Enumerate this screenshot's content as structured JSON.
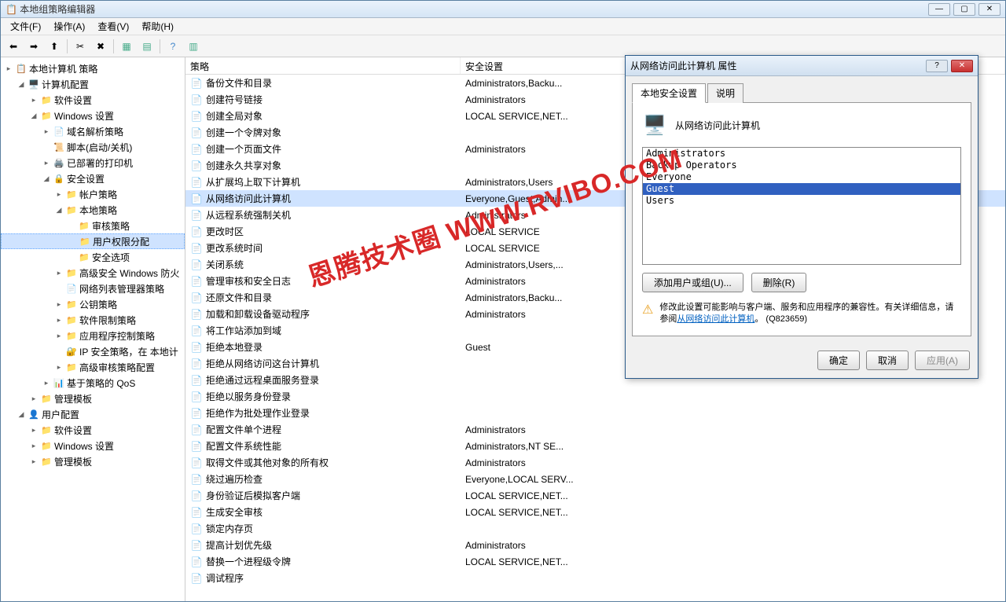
{
  "window": {
    "title": "本地组策略编辑器"
  },
  "menu": {
    "file": "文件(F)",
    "action": "操作(A)",
    "view": "查看(V)",
    "help": "帮助(H)"
  },
  "tree": {
    "root": "本地计算机 策略",
    "computer_config": "计算机配置",
    "software_settings": "软件设置",
    "windows_settings": "Windows 设置",
    "dns_policy": "域名解析策略",
    "scripts": "脚本(启动/关机)",
    "deployed_printers": "已部署的打印机",
    "security_settings": "安全设置",
    "account_policies": "帐户策略",
    "local_policies": "本地策略",
    "audit_policy": "审核策略",
    "user_rights": "用户权限分配",
    "security_options": "安全选项",
    "advanced_windows": "高级安全 Windows 防火",
    "network_list": "网络列表管理器策略",
    "public_key": "公钥策略",
    "software_restrict": "软件限制策略",
    "app_control": "应用程序控制策略",
    "ip_security": "IP 安全策略，在 本地计",
    "advanced_audit": "高级审核策略配置",
    "policy_qos": "基于策略的 QoS",
    "admin_templates": "管理模板",
    "user_config": "用户配置",
    "user_software": "软件设置",
    "user_windows": "Windows 设置",
    "user_admin": "管理模板"
  },
  "list": {
    "col_policy": "策略",
    "col_security": "安全设置",
    "rows": [
      {
        "name": "备份文件和目录",
        "val": "Administrators,Backu..."
      },
      {
        "name": "创建符号链接",
        "val": "Administrators"
      },
      {
        "name": "创建全局对象",
        "val": "LOCAL SERVICE,NET..."
      },
      {
        "name": "创建一个令牌对象",
        "val": ""
      },
      {
        "name": "创建一个页面文件",
        "val": "Administrators"
      },
      {
        "name": "创建永久共享对象",
        "val": ""
      },
      {
        "name": "从扩展坞上取下计算机",
        "val": "Administrators,Users"
      },
      {
        "name": "从网络访问此计算机",
        "val": "Everyone,Guest,Admin...",
        "selected": true
      },
      {
        "name": "从远程系统强制关机",
        "val": "Administrators"
      },
      {
        "name": "更改时区",
        "val": "LOCAL SERVICE"
      },
      {
        "name": "更改系统时间",
        "val": "LOCAL SERVICE"
      },
      {
        "name": "关闭系统",
        "val": "Administrators,Users,..."
      },
      {
        "name": "管理审核和安全日志",
        "val": "Administrators"
      },
      {
        "name": "还原文件和目录",
        "val": "Administrators,Backu..."
      },
      {
        "name": "加载和卸载设备驱动程序",
        "val": "Administrators"
      },
      {
        "name": "将工作站添加到域",
        "val": ""
      },
      {
        "name": "拒绝本地登录",
        "val": "Guest"
      },
      {
        "name": "拒绝从网络访问这台计算机",
        "val": ""
      },
      {
        "name": "拒绝通过远程桌面服务登录",
        "val": ""
      },
      {
        "name": "拒绝以服务身份登录",
        "val": ""
      },
      {
        "name": "拒绝作为批处理作业登录",
        "val": ""
      },
      {
        "name": "配置文件单个进程",
        "val": "Administrators"
      },
      {
        "name": "配置文件系统性能",
        "val": "Administrators,NT SE..."
      },
      {
        "name": "取得文件或其他对象的所有权",
        "val": "Administrators"
      },
      {
        "name": "绕过遍历检查",
        "val": "Everyone,LOCAL SERV..."
      },
      {
        "name": "身份验证后模拟客户端",
        "val": "LOCAL SERVICE,NET..."
      },
      {
        "name": "生成安全审核",
        "val": "LOCAL SERVICE,NET..."
      },
      {
        "name": "锁定内存页",
        "val": ""
      },
      {
        "name": "提高计划优先级",
        "val": "Administrators"
      },
      {
        "name": "替换一个进程级令牌",
        "val": "LOCAL SERVICE,NET..."
      },
      {
        "name": "调试程序",
        "val": ""
      }
    ]
  },
  "dialog": {
    "title": "从网络访问此计算机 属性",
    "tab_local": "本地安全设置",
    "tab_explain": "说明",
    "policy_name": "从网络访问此计算机",
    "users": [
      "Administrators",
      "Backup Operators",
      "Everyone",
      "Guest",
      "Users"
    ],
    "selected_user_index": 3,
    "add_btn": "添加用户或组(U)...",
    "remove_btn": "删除(R)",
    "warning_text": "修改此设置可能影响与客户端、服务和应用程序的兼容性。有关详细信息，请参阅",
    "warning_link": "从网络访问此计算机",
    "warning_kb": "。 (Q823659)",
    "ok": "确定",
    "cancel": "取消",
    "apply": "应用(A)"
  },
  "watermark": "恩腾技术圈 WWW.RVIBO.COM"
}
